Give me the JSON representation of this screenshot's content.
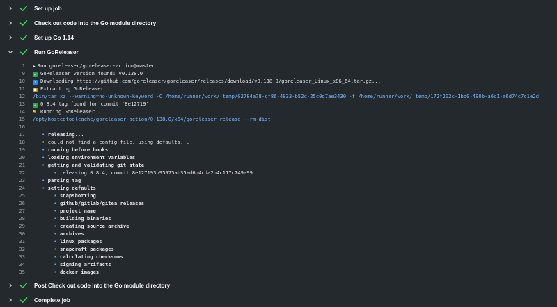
{
  "steps_before": [
    {
      "label": "Set up job"
    },
    {
      "label": "Check out code into the Go module directory"
    },
    {
      "label": "Set up Go 1.14"
    }
  ],
  "expanded_step": {
    "label": "Run GoReleaser"
  },
  "log": [
    {
      "n": "1",
      "text": "Run goreleaser/goreleaser-action@master",
      "kind": "group"
    },
    {
      "n": "9",
      "text": "GoReleaser version found: v0.138.0",
      "kind": "check"
    },
    {
      "n": "10",
      "text": "Downloading https://github.com/goreleaser/goreleaser/releases/download/v0.138.0/goreleaser_Linux_x86_64.tar.gz...",
      "kind": "download"
    },
    {
      "n": "11",
      "text": "Extracting GoReleaser...",
      "kind": "box"
    },
    {
      "n": "12",
      "text": "/bin/tar xz --warning=no-unknown-keyword -C /home/runner/work/_temp/02784a78-cf86-4833-b52c-25c0d7ae3430 -f /home/runner/work/_temp/172f202c-1bb0-490b-a6c1-a6d74c7c1e2d",
      "kind": "cmd"
    },
    {
      "n": "13",
      "text": "0.8.4 tag found for commit '8e12719'",
      "kind": "check"
    },
    {
      "n": "14",
      "text": "Running GoReleaser...",
      "kind": "run"
    },
    {
      "n": "15",
      "text": "/opt/hostedtoolcache/goreleaser-action/0.138.0/x64/goreleaser release --rm-dist",
      "kind": "cmd"
    },
    {
      "n": "16",
      "text": "",
      "kind": "plain"
    },
    {
      "n": "17",
      "text": "releasing...",
      "kind": "bullet",
      "indent": 1,
      "bold": true
    },
    {
      "n": "18",
      "text": "could not find a config file, using defaults...",
      "kind": "warn",
      "indent": 1
    },
    {
      "n": "19",
      "text": "running before hooks",
      "kind": "bullet",
      "indent": 1,
      "bold": true
    },
    {
      "n": "20",
      "text": "loading environment variables",
      "kind": "bullet",
      "indent": 1,
      "bold": true
    },
    {
      "n": "21",
      "text": "getting and validating git state",
      "kind": "bullet",
      "indent": 1,
      "bold": true
    },
    {
      "n": "22",
      "text": "releasing 0.8.4, commit 8e127193b95975ab35ad6b4cda2b4c117c749a99",
      "kind": "bullet",
      "indent": 2
    },
    {
      "n": "23",
      "text": "parsing tag",
      "kind": "bullet",
      "indent": 1,
      "bold": true
    },
    {
      "n": "24",
      "text": "setting defaults",
      "kind": "bullet",
      "indent": 1,
      "bold": true
    },
    {
      "n": "25",
      "text": "snapshotting",
      "kind": "bullet",
      "indent": 2,
      "bold": true
    },
    {
      "n": "26",
      "text": "github/gitlab/gitea releases",
      "kind": "bullet",
      "indent": 2,
      "bold": true
    },
    {
      "n": "27",
      "text": "project name",
      "kind": "bullet",
      "indent": 2,
      "bold": true
    },
    {
      "n": "28",
      "text": "building binaries",
      "kind": "bullet",
      "indent": 2,
      "bold": true
    },
    {
      "n": "29",
      "text": "creating source archive",
      "kind": "bullet",
      "indent": 2,
      "bold": true
    },
    {
      "n": "30",
      "text": "archives",
      "kind": "bullet",
      "indent": 2,
      "bold": true
    },
    {
      "n": "31",
      "text": "linux packages",
      "kind": "bullet",
      "indent": 2,
      "bold": true
    },
    {
      "n": "32",
      "text": "snapcraft packages",
      "kind": "bullet",
      "indent": 2,
      "bold": true
    },
    {
      "n": "33",
      "text": "calculating checksums",
      "kind": "bullet",
      "indent": 2,
      "bold": true
    },
    {
      "n": "34",
      "text": "signing artifacts",
      "kind": "bullet",
      "indent": 2,
      "bold": true
    },
    {
      "n": "35",
      "text": "docker images",
      "kind": "bullet",
      "indent": 2,
      "bold": true
    }
  ],
  "steps_after": [
    {
      "label": "Post Check out code into the Go module directory"
    },
    {
      "label": "Complete job"
    }
  ],
  "icons": {
    "collapsed": "chevron-right-icon",
    "expanded": "chevron-down-icon",
    "status": "check-icon"
  },
  "colors": {
    "background": "#24292e",
    "success": "#34d058",
    "command": "#79b8ff",
    "line_number": "#959da5"
  }
}
